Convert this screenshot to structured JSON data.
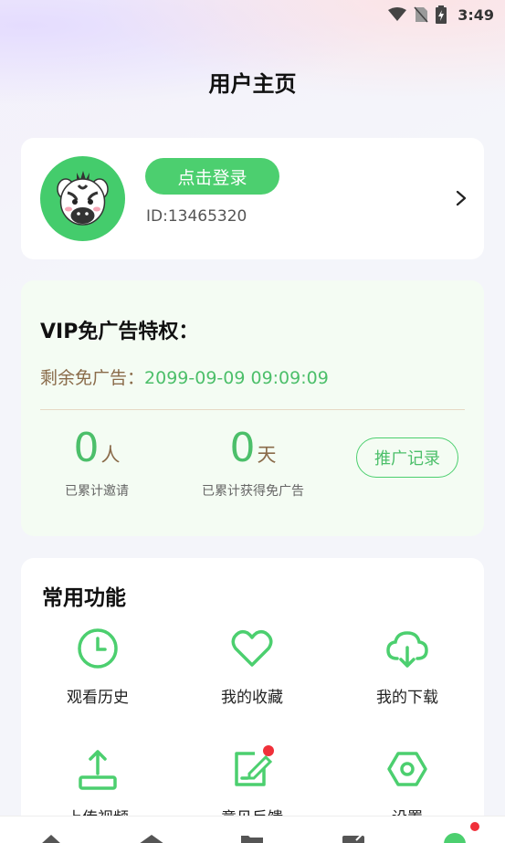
{
  "status_bar": {
    "time": "3:49"
  },
  "header": {
    "title": "用户主页"
  },
  "profile": {
    "login_label": "点击登录",
    "user_id": "ID:13465320"
  },
  "vip": {
    "title": "VIP免广告特权：",
    "remain_label": "剩余免广告：",
    "remain_value": "2099-09-09 09:09:09",
    "invited": {
      "value": "0",
      "unit": "人",
      "label": "已累计邀请"
    },
    "days": {
      "value": "0",
      "unit": "天",
      "label": "已累计获得免广告"
    },
    "promo_button": "推广记录"
  },
  "functions": {
    "title": "常用功能",
    "items": [
      {
        "label": "观看历史",
        "icon": "clock-icon"
      },
      {
        "label": "我的收藏",
        "icon": "heart-icon"
      },
      {
        "label": "我的下载",
        "icon": "cloud-download-icon"
      },
      {
        "label": "上传视频",
        "icon": "upload-icon"
      },
      {
        "label": "意见反馈",
        "icon": "feedback-edit-icon"
      },
      {
        "label": "设置",
        "icon": "settings-hexagon-icon"
      }
    ]
  },
  "colors": {
    "accent": "#4ccf6f",
    "accent_text": "#4cbf6a",
    "brown_text": "#8a6b4a",
    "badge_red": "#f0303a"
  }
}
